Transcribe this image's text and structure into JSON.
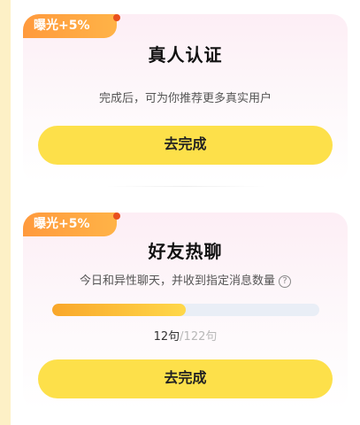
{
  "cards": [
    {
      "badge": "曝光+5%",
      "title": "真人认证",
      "subtitle": "完成后，可为你推荐更多真实用户",
      "button": "去完成"
    },
    {
      "badge": "曝光+5%",
      "title": "好友热聊",
      "subtitle": "今日和异性聊天，并收到指定消息数量",
      "help_icon": "question-circle-icon",
      "progress": {
        "current": "12句",
        "total": "/122句",
        "fraction": 0.5
      },
      "button": "去完成"
    }
  ],
  "colors": {
    "badge": "#ff9a3d",
    "button": "#fde04a",
    "progress_fill": "#f9a72a",
    "progress_track": "#e9eef6"
  }
}
